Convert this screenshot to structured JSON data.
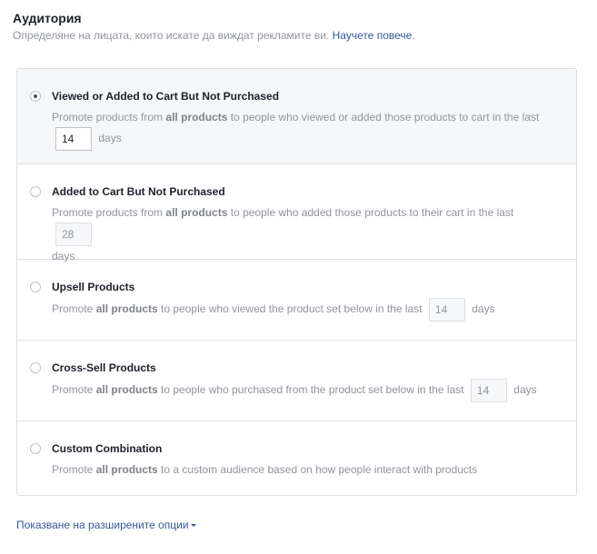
{
  "header": {
    "title": "Аудитория",
    "subtitle": "Определяне на лицата, които искате да виждат рекламите ви.",
    "learn_more": "Научете повече",
    "period": "."
  },
  "options": [
    {
      "title": "Viewed or Added to Cart But Not Purchased",
      "desc_pre": "Promote products from ",
      "desc_bold": "all products",
      "desc_post": " to people who viewed or added those products to cart in the last",
      "days_value": "14",
      "days_label": "days",
      "selected": true
    },
    {
      "title": "Added to Cart But Not Purchased",
      "desc_pre": "Promote products from ",
      "desc_bold": "all products",
      "desc_post": " to people who added those products to their cart in the last",
      "days_value": "28",
      "days_label": "days",
      "selected": false
    },
    {
      "title": "Upsell Products",
      "desc_pre": "Promote ",
      "desc_bold": "all products",
      "desc_post": " to people who viewed the product set below in the last",
      "days_value": "14",
      "days_label": "days",
      "selected": false
    },
    {
      "title": "Cross-Sell Products",
      "desc_pre": "Promote ",
      "desc_bold": "all products",
      "desc_post": " to people who purchased from the product set below in the last",
      "days_value": "14",
      "days_label": "days",
      "selected": false
    },
    {
      "title": "Custom Combination",
      "desc_pre": "Promote ",
      "desc_bold": "all products",
      "desc_post": " to a custom audience based on how people interact with products",
      "selected": false
    }
  ],
  "advanced_link": "Показване на разширените опции"
}
